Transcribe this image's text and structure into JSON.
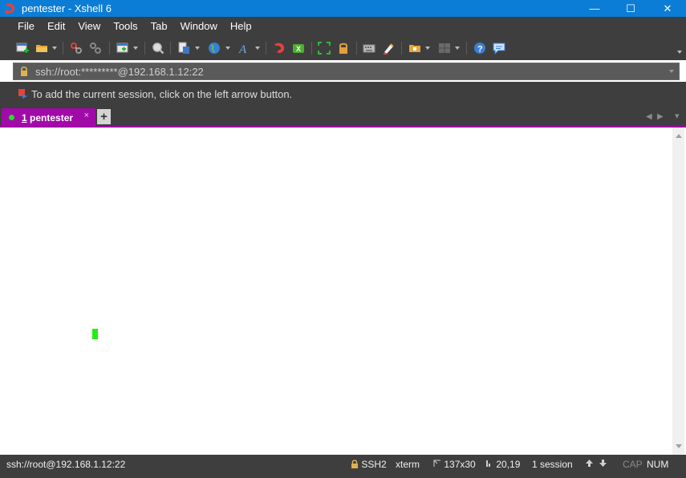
{
  "window": {
    "title": "pentester - Xshell 6",
    "controls": {
      "minimize": "—",
      "maximize": "☐",
      "close": "✕"
    }
  },
  "menu": [
    "File",
    "Edit",
    "View",
    "Tools",
    "Tab",
    "Window",
    "Help"
  ],
  "toolbar": {
    "icons": [
      "new-session-icon",
      "open-folder-icon",
      "connect-icon",
      "disconnect-icon",
      "new-tab-icon",
      "find-icon",
      "transfer-icon",
      "globe-icon",
      "font-icon",
      "xftp-icon",
      "xmanager-icon",
      "fullscreen-icon",
      "lock-icon",
      "keyboard-icon",
      "highlight-icon",
      "script-icon",
      "layout-icon",
      "help-icon",
      "chat-icon"
    ]
  },
  "address": {
    "value": "ssh://root:*********@192.168.1.12:22"
  },
  "info": {
    "tip": "To add the current session, click on the left arrow button."
  },
  "tabs": [
    {
      "number": "1",
      "name": "pentester",
      "label": "1 pentester",
      "close": "×",
      "status_color": "#19e61e"
    }
  ],
  "add_tab": "+",
  "tab_nav": {
    "prev": "◀",
    "next": "▶",
    "menu": "▾"
  },
  "statusbar": {
    "connection": "ssh://root@192.168.1.12:22",
    "protocol": "SSH2",
    "terminal_type": "xterm",
    "size": "137x30",
    "cursor_pos": "20,19",
    "sessions": "1 session",
    "caps": "CAP",
    "num": "NUM"
  },
  "colors": {
    "accent_tab": "#a10aa8",
    "titlebar": "#0c7dd6",
    "cursor": "#22ee11",
    "chrome": "#3e3e3e"
  }
}
